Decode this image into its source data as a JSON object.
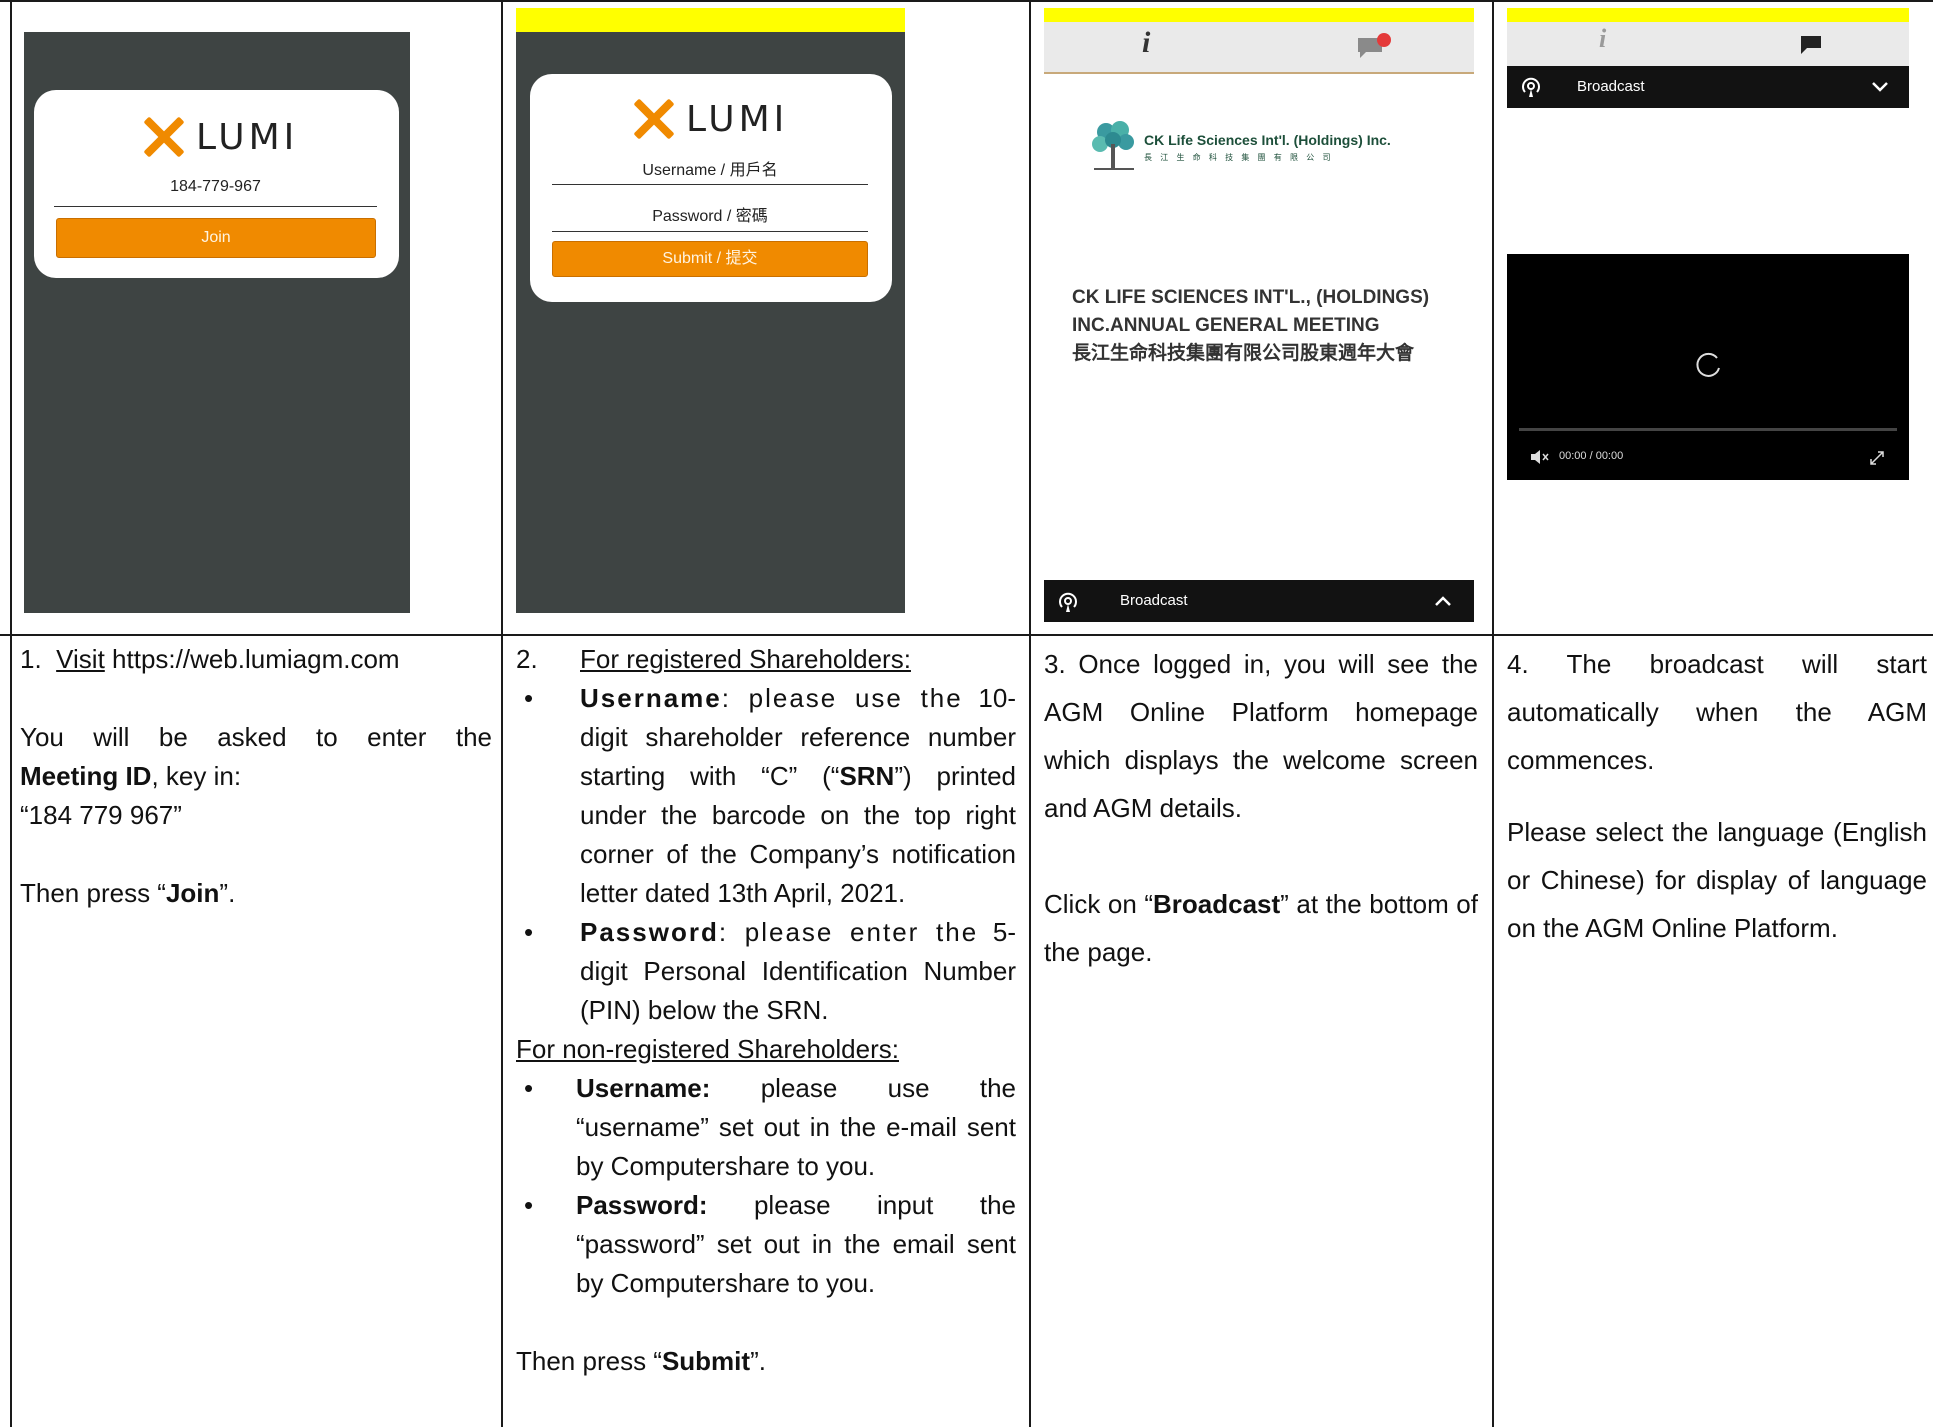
{
  "colors": {
    "lumi_orange": "#f08a00",
    "screen_bg": "#3e4443",
    "highlight": "#ffff00"
  },
  "screen1": {
    "logo_text": "LUMI",
    "meeting_id_value": "184-779-967",
    "join_label": "Join"
  },
  "screen2": {
    "logo_text": "LUMI",
    "username_label": "Username / 用戶名",
    "password_label": "Password / 密碼",
    "submit_label": "Submit / 提交"
  },
  "screen3": {
    "info_icon": "info-icon",
    "chat_icon": "chat-notification-icon",
    "company_logo_text": "CK Life Sciences Int'l. (Holdings) Inc.",
    "company_logo_chinese": "長 江 生 命 科 技 集 團 有 限 公 司",
    "meeting_title_line1": "CK LIFE SCIENCES INT'L., (HOLDINGS)",
    "meeting_title_line2": "INC.ANNUAL GENERAL MEETING",
    "meeting_title_line3": "長江生命科技集團有限公司股東週年大會",
    "broadcast_label": "Broadcast"
  },
  "screen4": {
    "broadcast_label": "Broadcast",
    "video_time": "00:00 / 00:00"
  },
  "step1": {
    "num": "1.",
    "visit": "Visit",
    "url": "https://web.lumiagm.com",
    "asked": "You will be asked to enter the",
    "meeting_id": "Meeting ID",
    "key_in": ", key in:",
    "id_quoted": "“184 779 967”",
    "then_press": "Then press “",
    "join": "Join",
    "end": "”."
  },
  "step2": {
    "num": "2.",
    "registered_heading": "For registered Shareholders:",
    "username_label": "Username",
    "username_text_a": ": please use the",
    "username_text_b": "10-digit shareholder reference number starting with “C” (“",
    "srn": "SRN",
    "username_text_c": "”) printed under the barcode on the top right corner of the Company’s notification letter dated 13th April, 2021.",
    "password_label": "Password",
    "password_text_a": ": please enter the",
    "password_text_b": "5-digit Personal Identification Number (PIN) below the SRN.",
    "nonregistered_heading": "For non-registered Shareholders:",
    "nr_username_label": "Username:",
    "nr_username_text": " please use the “username” set out in the e-mail sent by Computershare to you.",
    "nr_password_label": "Password:",
    "nr_password_text": " please input the “password” set out in the email sent by Computershare to you.",
    "then_press": "Then press “",
    "submit": "Submit",
    "end": "”."
  },
  "step3": {
    "text_a": "3. Once logged in, you will see the AGM Online Platform homepage which displays the welcome screen and AGM details.",
    "click_on": "Click on “",
    "broadcast": "Broadcast",
    "text_b": "” at the bottom of the page."
  },
  "step4": {
    "text_a": "4. The broadcast will start automatically when the AGM commences.",
    "text_b": "Please select the language (English or Chinese) for display of language on the AGM Online Platform."
  }
}
